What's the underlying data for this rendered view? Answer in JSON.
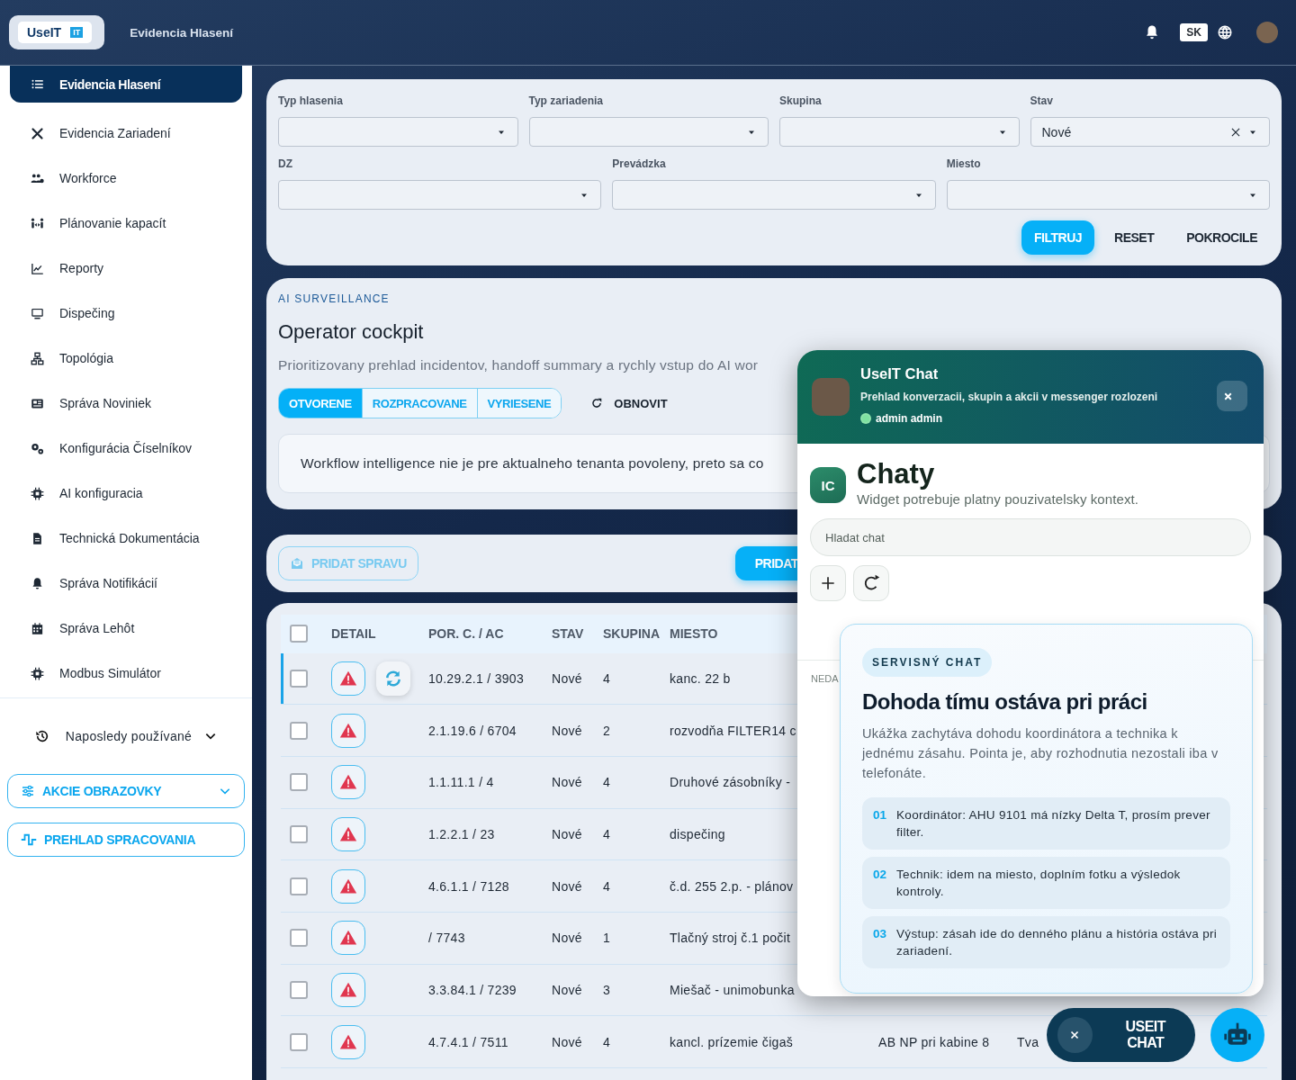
{
  "header": {
    "logo": "UseIT",
    "logo_badge": "IT",
    "title": "Evidencia Hlasení",
    "language": "SK"
  },
  "sidebar": {
    "items": [
      {
        "label": "Evidencia Hlasení",
        "selected": true
      },
      {
        "label": "Evidencia Zariadení",
        "selected": false
      },
      {
        "label": "Workforce",
        "selected": false
      },
      {
        "label": "Plánovanie kapacít",
        "selected": false
      },
      {
        "label": "Reporty",
        "selected": false
      },
      {
        "label": "Dispečing",
        "selected": false
      },
      {
        "label": "Topológia",
        "selected": false
      },
      {
        "label": "Správa Noviniek",
        "selected": false
      },
      {
        "label": "Konfigurácia Číselníkov",
        "selected": false
      },
      {
        "label": "AI konfiguracia",
        "selected": false
      },
      {
        "label": "Technická Dokumentácia",
        "selected": false
      },
      {
        "label": "Správa Notifikácií",
        "selected": false
      },
      {
        "label": "Správa Lehôt",
        "selected": false
      },
      {
        "label": "Modbus Simulátor",
        "selected": false
      }
    ],
    "recent": {
      "label": "Naposledy používané",
      "expanded": false
    },
    "buttons": [
      {
        "label": "AKCIE OBRAZOVKY",
        "kind": "dropdown"
      },
      {
        "label": "PREHLAD SPRACOVANIA",
        "kind": "link"
      }
    ]
  },
  "filters": {
    "rows": [
      [
        {
          "label": "Typ hlasenia",
          "clearable": false
        },
        {
          "label": "Typ zariadenia",
          "clearable": false
        },
        {
          "label": "Skupina",
          "clearable": false
        },
        {
          "label": "Stav",
          "value": "Nové",
          "clearable": true
        }
      ],
      [
        {
          "label": "DZ",
          "clearable": false
        },
        {
          "label": "Prevádzka",
          "clearable": false
        },
        {
          "label": "Miesto",
          "clearable": false
        }
      ]
    ],
    "buttons": [
      {
        "label": "FILTRUJ",
        "kind": "primary"
      },
      {
        "label": "RESET",
        "kind": "text"
      },
      {
        "label": "POKROCILE",
        "kind": "text"
      }
    ]
  },
  "ai_card": {
    "eyebrow": "AI SURVEILLANCE",
    "title": "Operator cockpit",
    "description": "Prioritizovany prehlad incidentov, handoff summary a rychly vstup do AI wor",
    "tabs": [
      {
        "label": "OTVORENE",
        "selected": true
      },
      {
        "label": "ROZPRACOVANE",
        "selected": false
      },
      {
        "label": "VYRIESENE",
        "selected": false
      }
    ],
    "refresh_button": "OBNOVIT",
    "notice": "Workflow intelligence nie je pre aktualneho tenanta povoleny, preto sa co"
  },
  "actions": {
    "buttons": [
      {
        "label": "PRIDAT SPRAVU",
        "kind": "outline",
        "disabled": true
      },
      {
        "label": "PRIDAT",
        "kind": "primary",
        "disabled": false
      }
    ]
  },
  "table": {
    "all_checked": false,
    "columns": [
      "DETAIL",
      "POR. C. / AC",
      "STAV",
      "SKUPINA",
      "MIESTO"
    ],
    "rows": [
      {
        "checked": false,
        "selected": true,
        "sync": true,
        "por": "10.29.2.1 / 3903",
        "stav": "Nové",
        "skupina": "4",
        "miesto": "kanc. 22 b"
      },
      {
        "checked": false,
        "selected": false,
        "sync": false,
        "por": "2.1.19.6 / 6704",
        "stav": "Nové",
        "skupina": "2",
        "miesto": "rozvodňa FILTER14 c"
      },
      {
        "checked": false,
        "selected": false,
        "sync": false,
        "por": "1.1.11.1 / 4",
        "stav": "Nové",
        "skupina": "4",
        "miesto": "Druhové zásobníky -"
      },
      {
        "checked": false,
        "selected": false,
        "sync": false,
        "por": "1.2.2.1 / 23",
        "stav": "Nové",
        "skupina": "4",
        "miesto": "dispečing"
      },
      {
        "checked": false,
        "selected": false,
        "sync": false,
        "por": "4.6.1.1 / 7128",
        "stav": "Nové",
        "skupina": "4",
        "miesto": "č.d. 255 2.p. - plánov"
      },
      {
        "checked": false,
        "selected": false,
        "sync": false,
        "por": "/ 7743",
        "stav": "Nové",
        "skupina": "1",
        "miesto": "Tlačný stroj č.1 počit"
      },
      {
        "checked": false,
        "selected": false,
        "sync": false,
        "por": "3.3.84.1 / 7239",
        "stav": "Nové",
        "skupina": "3",
        "miesto": "Miešač - unimobunka"
      },
      {
        "checked": false,
        "selected": false,
        "sync": false,
        "por": "4.7.4.1 / 7511",
        "stav": "Nové",
        "skupina": "4",
        "miesto": "kancl. prízemie čigaš",
        "column_7": "AB NP pri kabine 8",
        "column_8": "Tva"
      }
    ]
  },
  "chat": {
    "title": "UseIT Chat",
    "subtitle": "Prehlad konverzacii, skupin a akcii v messenger rozlozeni",
    "user": "admin admin",
    "online": true,
    "badge": "IC",
    "heading": "Chaty",
    "heading_note": "Widget potrebuje platny pouzivatelsky kontext.",
    "search": {
      "placeholder": "Hladat chat"
    },
    "section_label": "NEDA"
  },
  "tooltip": {
    "tag": "SERVISNÝ CHAT",
    "title": "Dohoda tímu ostáva pri práci",
    "text": "Ukážka zachytáva dohodu koordinátora a technika k jednému zásahu. Pointa je, aby rozhodnutia nezostali iba v telefonáte.",
    "steps": [
      {
        "number": "01",
        "text": "Koordinátor: AHU 9101 má nízky Delta T, prosím prever filter."
      },
      {
        "number": "02",
        "text": "Technik: idem na miesto, doplním fotku a výsledok kontroly."
      },
      {
        "number": "03",
        "text": "Výstup: zásah ide do denného plánu a história ostáva pri zariadení."
      }
    ]
  },
  "launcher": {
    "label": "USEIT CHAT"
  }
}
